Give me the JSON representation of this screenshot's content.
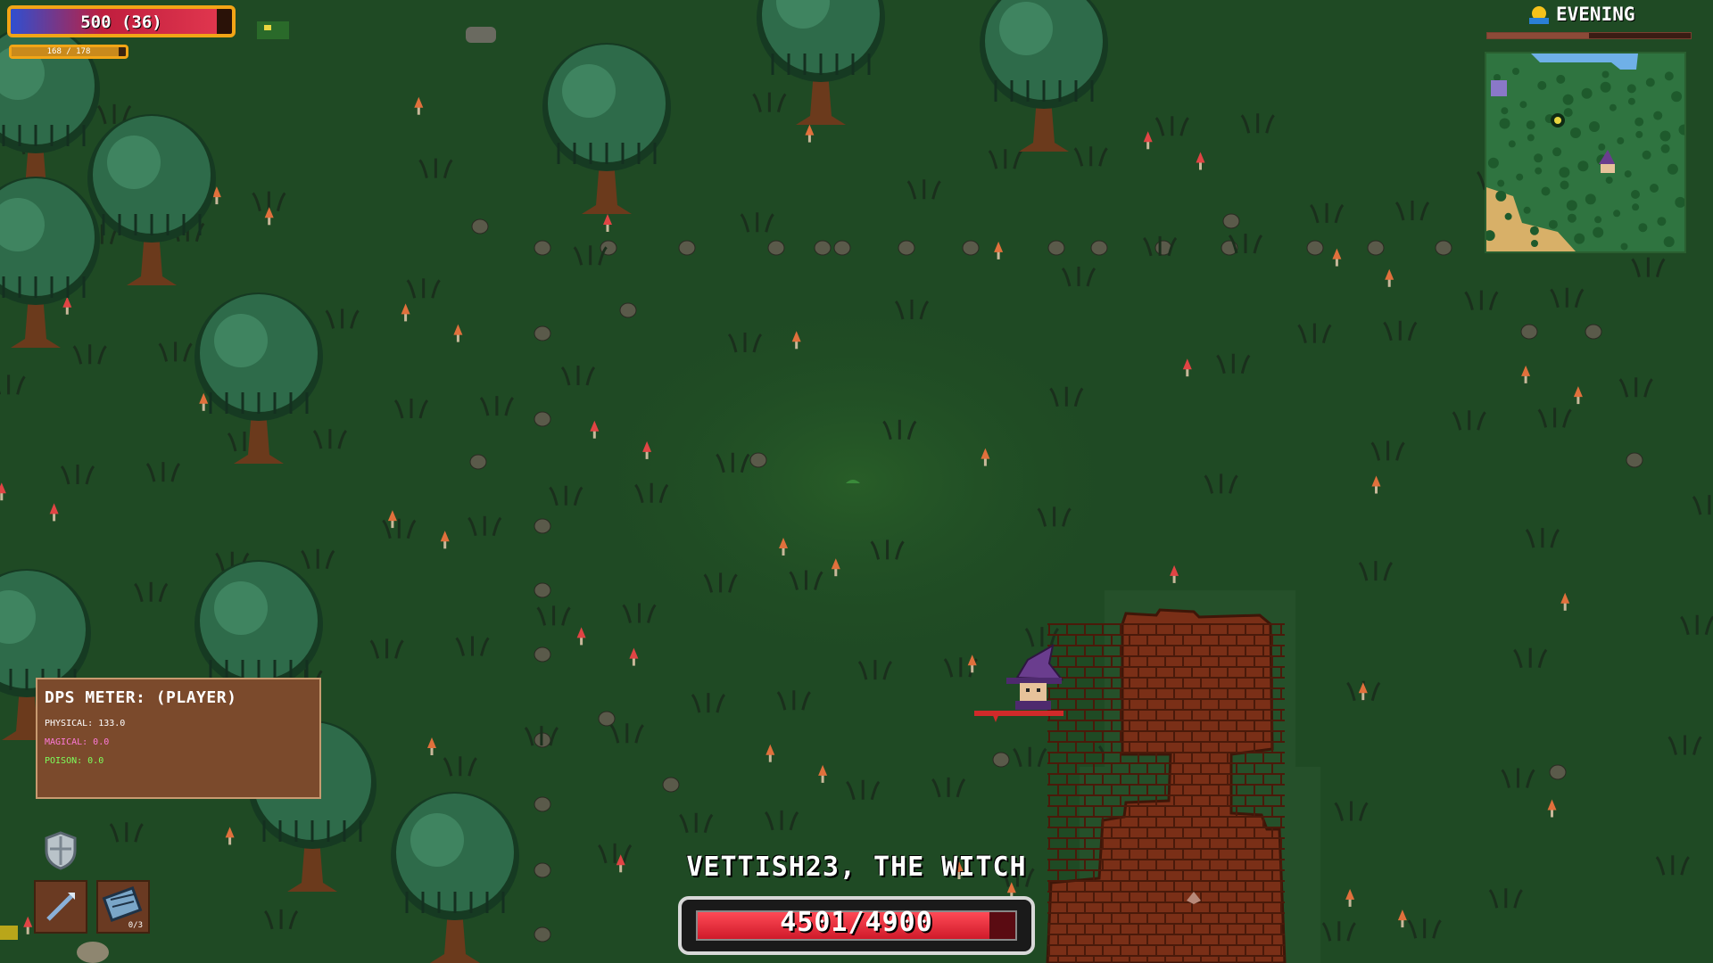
{
  "player": {
    "hp_text": "500 (36)",
    "hp_fraction": 0.93,
    "xp_text": "168 / 178",
    "xp_fraction": 0.94
  },
  "time_of_day": {
    "label": "EVENING",
    "icon": "sun-horizon-icon",
    "progress_fraction": 0.5
  },
  "minimap": {
    "icon": "minimap"
  },
  "dps_meter": {
    "title": "DPS METER: (PLAYER)",
    "rows": [
      {
        "label": "PHYSICAL: 133.0",
        "color": "#ffffff"
      },
      {
        "label": "MAGICAL: 0.0",
        "color": "#ff7ad9"
      },
      {
        "label": "POISON: 0.0",
        "color": "#7cff5c"
      }
    ]
  },
  "hotbar": {
    "armor_icon": "shield-icon",
    "weapon_icon": "wand-icon",
    "item_icon": "scroll-icon",
    "item_count": "0/3"
  },
  "boss": {
    "name": "VETTISH23, THE WITCH",
    "hp_text": "4501/4900",
    "hp_fraction": 0.918
  },
  "colors": {
    "ground": "#1f4a24",
    "hp_border": "#f2a516",
    "boss_hp": "#e0303c",
    "panel": "#7b4a2c"
  }
}
